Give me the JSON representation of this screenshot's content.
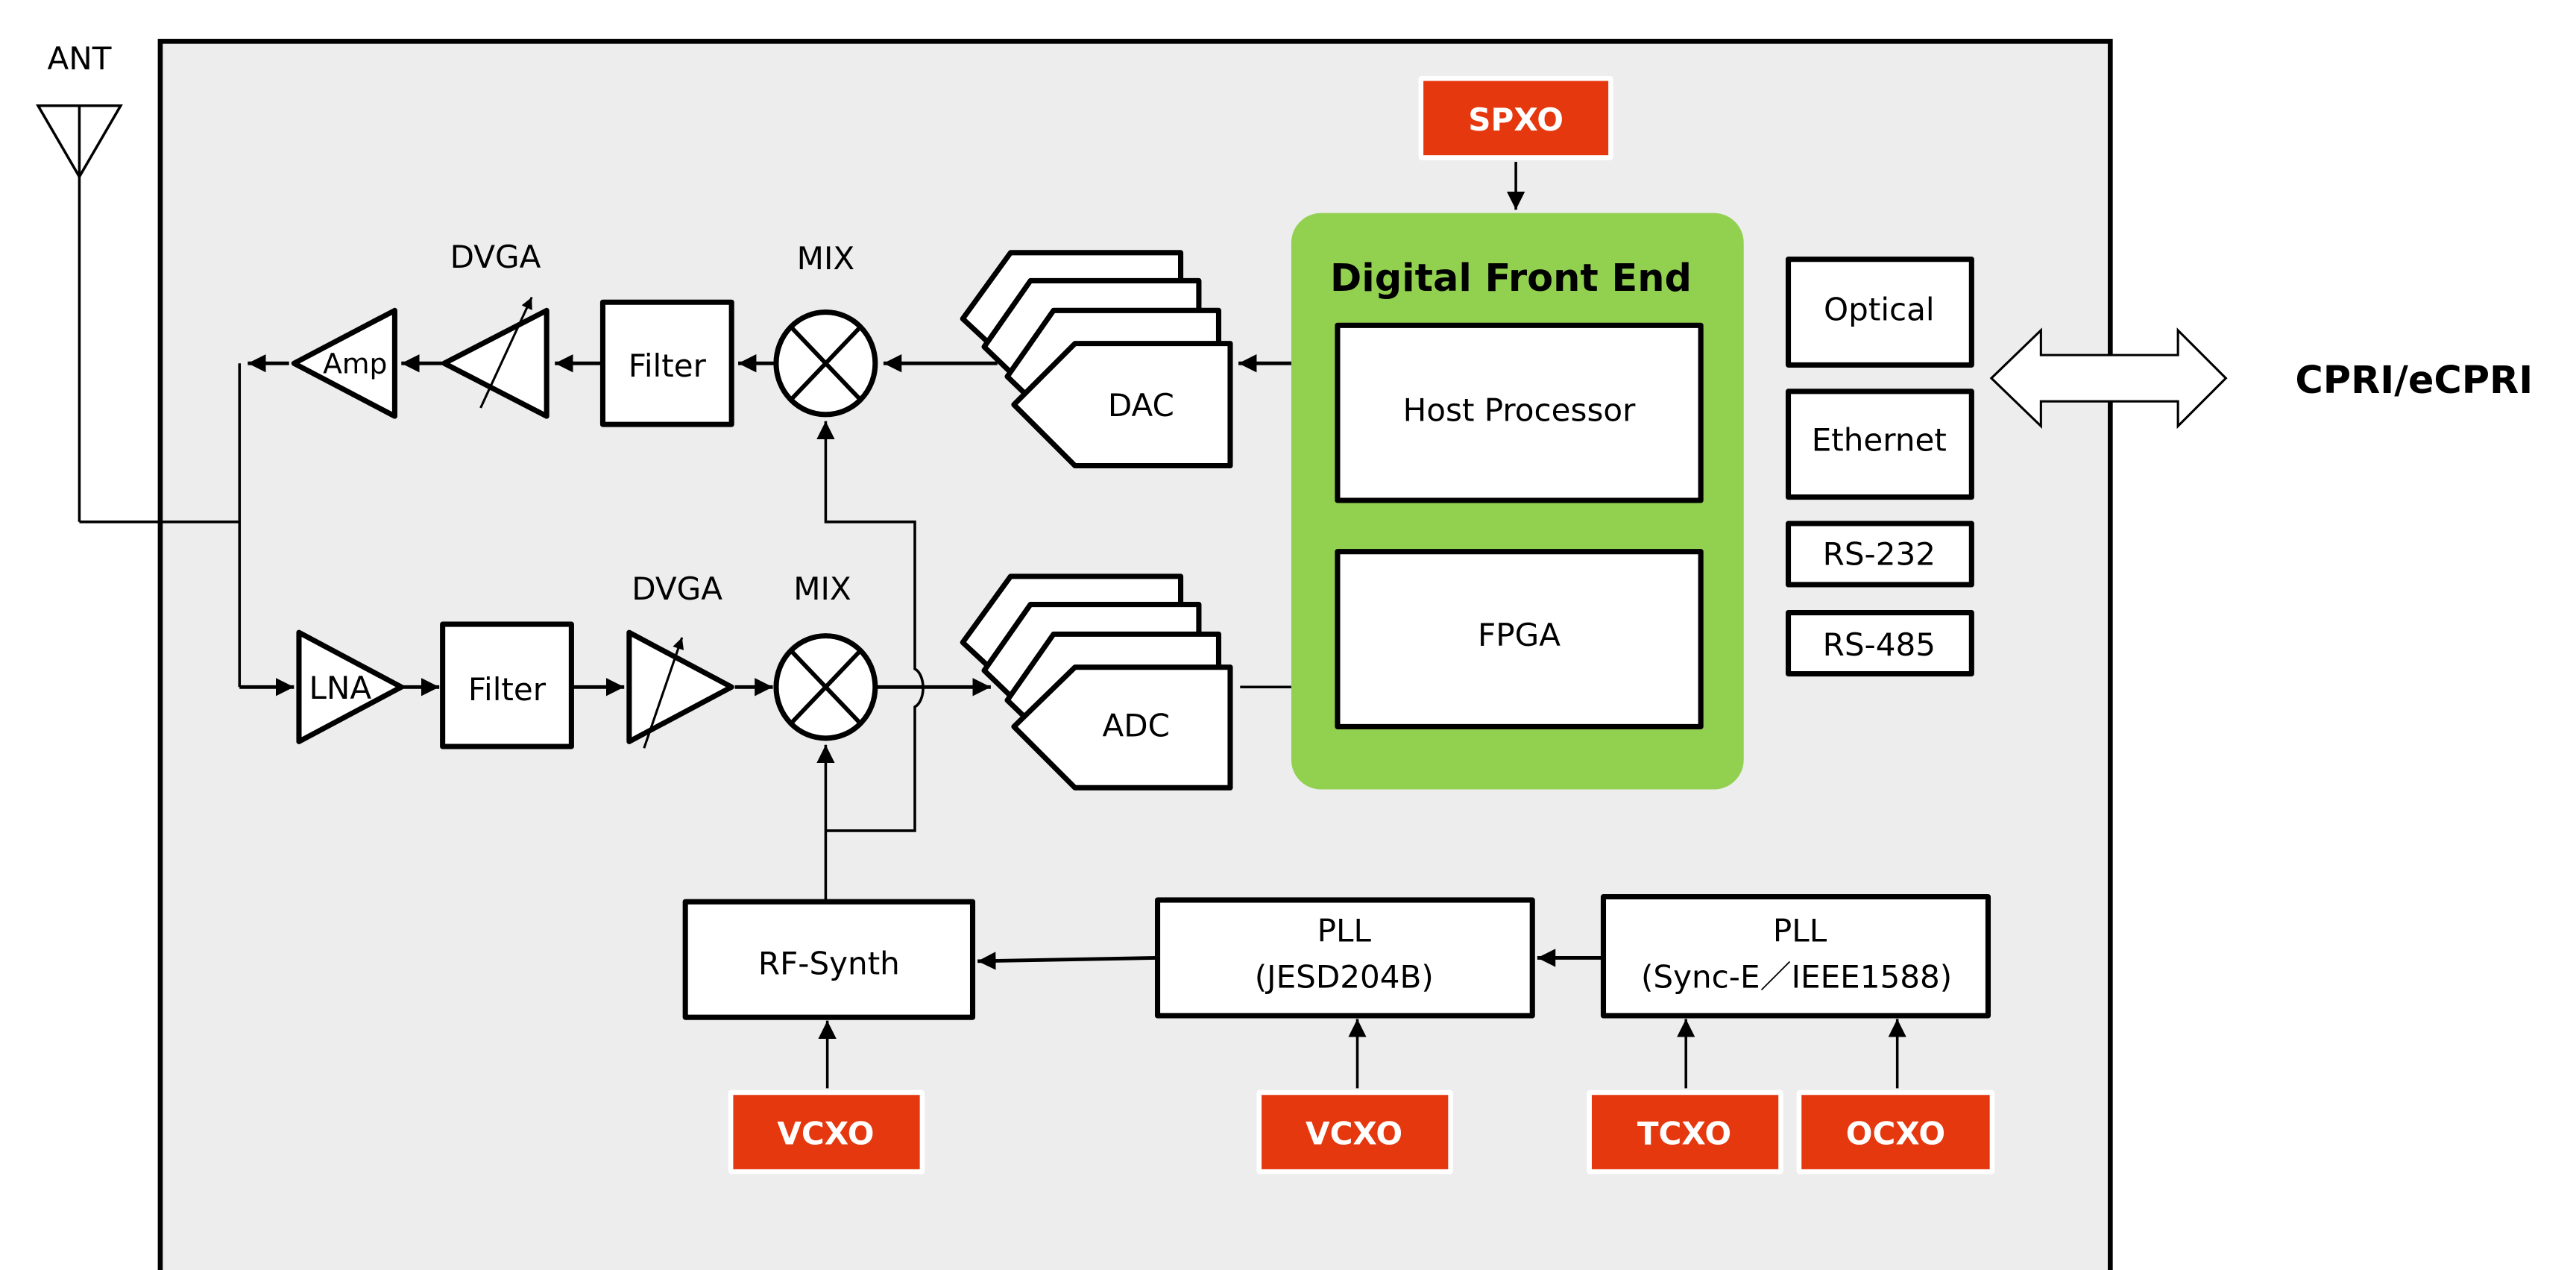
{
  "diagram": {
    "antenna_label": "ANT",
    "external_interface_label": "CPRI/eCPRI",
    "colors": {
      "board_background": "#EDEDED",
      "dfe_background": "#92D050",
      "oscillator_fill": "#E5380F",
      "oscillator_text": "#FFFFFF",
      "line": "#000000"
    },
    "tx_chain": {
      "amp": "Amp",
      "dvga_label": "DVGA",
      "filter": "Filter",
      "mix_label": "MIX",
      "converter": "DAC"
    },
    "rx_chain": {
      "lna": "LNA",
      "filter": "Filter",
      "dvga_label": "DVGA",
      "mix_label": "MIX",
      "converter": "ADC"
    },
    "digital_front_end": {
      "title": "Digital Front End",
      "blocks": [
        "Host Processor",
        "FPGA"
      ]
    },
    "interfaces": [
      "Optical",
      "Ethernet",
      "RS-232",
      "RS-485"
    ],
    "clocking": {
      "rf_synth": "RF-Synth",
      "pll_jesd": {
        "line1": "PLL",
        "line2": "(JESD204B)"
      },
      "pll_sync": {
        "line1": "PLL",
        "line2": "(Sync-E／IEEE1588)"
      }
    },
    "oscillators": {
      "spxo": "SPXO",
      "vcxo_rf": "VCXO",
      "vcxo_pll": "VCXO",
      "tcxo": "TCXO",
      "ocxo": "OCXO"
    }
  }
}
